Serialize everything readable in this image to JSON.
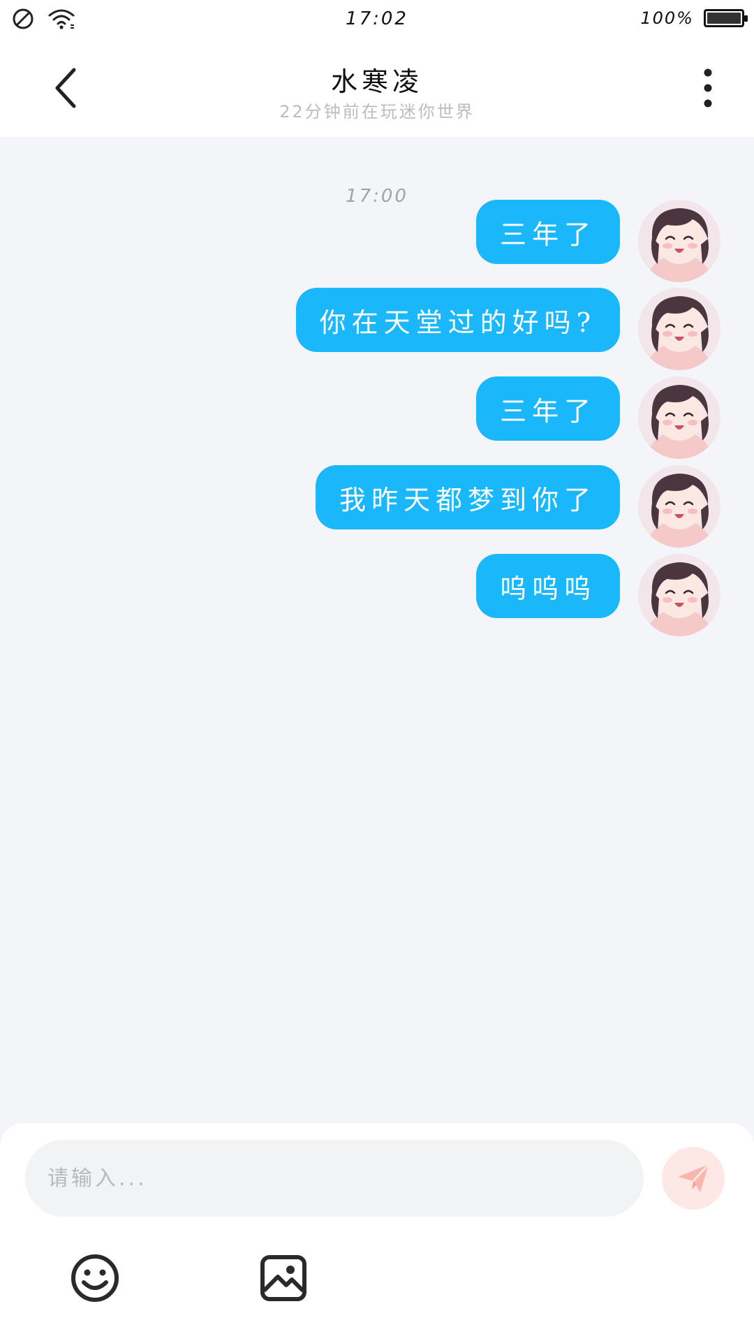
{
  "status_bar": {
    "time": "17:02",
    "battery_text": "100%",
    "icons": [
      "no-sim-icon",
      "wifi-icon",
      "battery-icon"
    ]
  },
  "header": {
    "title": "水寒凌",
    "subtitle": "22分钟前在玩迷你世界",
    "back_icon": "back-chevron-icon",
    "more_icon": "more-vertical-icon"
  },
  "chat": {
    "time_divider": "17:00",
    "messages": [
      {
        "text": "三年了",
        "side": "right"
      },
      {
        "text": "你在天堂过的好吗?",
        "side": "right"
      },
      {
        "text": "三年了",
        "side": "right"
      },
      {
        "text": "我昨天都梦到你了",
        "side": "right"
      },
      {
        "text": "呜呜呜",
        "side": "right"
      }
    ]
  },
  "composer": {
    "placeholder": "请输入...",
    "value": "",
    "send_icon": "send-icon",
    "tools": [
      "emoji-icon",
      "image-icon"
    ]
  },
  "colors": {
    "bubble": "#1ab7fb",
    "background": "#f3f5f8",
    "send_button": "#fde8e6",
    "send_icon": "#f9b6ad"
  }
}
